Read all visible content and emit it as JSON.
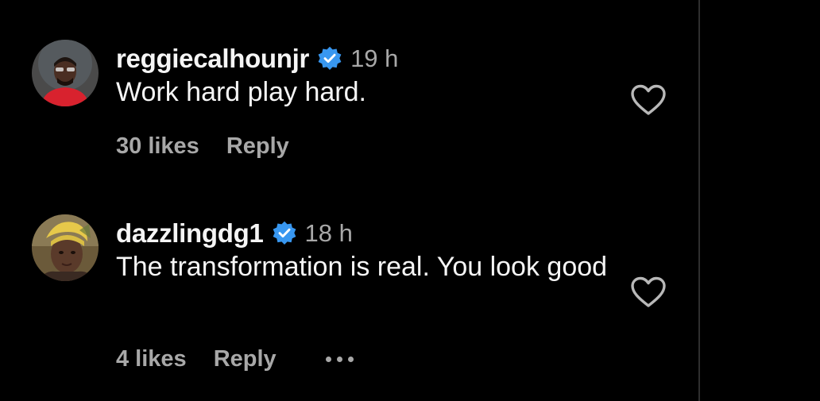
{
  "comments": [
    {
      "username": "reggiecalhounjr",
      "verified": true,
      "time": "19 h",
      "text": "Work hard play hard.",
      "likes": "30 likes",
      "reply": "Reply"
    },
    {
      "username": "dazzlingdg1",
      "verified": true,
      "time": "18 h",
      "text": "The transformation is real. You look good",
      "likes": "4 likes",
      "reply": "Reply"
    }
  ],
  "icons": {
    "verified": "verified-badge-icon",
    "like": "heart-outline-icon",
    "more": "more-options-icon"
  },
  "colors": {
    "background": "#000000",
    "primary_text": "#f5f5f5",
    "secondary_text": "#a8a8a8",
    "verified_blue": "#3897f0"
  }
}
